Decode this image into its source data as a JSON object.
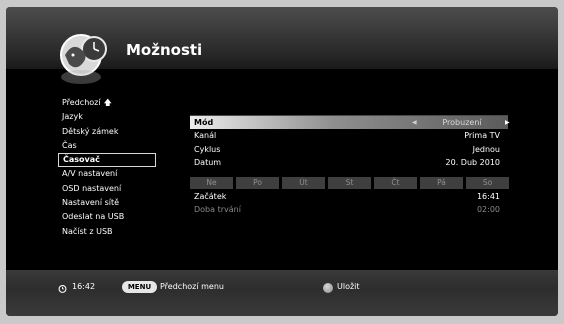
{
  "header": {
    "title": "Možnosti"
  },
  "menu": {
    "items": [
      {
        "label": "Předchozí",
        "has_up_arrow": true
      },
      {
        "label": "Jazyk"
      },
      {
        "label": "Dětský zámek"
      },
      {
        "label": "Čas"
      },
      {
        "label": "Časovač",
        "active": true
      },
      {
        "label": "A/V nastavení"
      },
      {
        "label": "OSD nastavení"
      },
      {
        "label": "Nastavení sítě"
      },
      {
        "label": "Odeslat na USB"
      },
      {
        "label": "Načíst z USB"
      }
    ]
  },
  "settings": {
    "mode": {
      "label": "Mód",
      "value": "Probuzení"
    },
    "channel": {
      "label": "Kanál",
      "value": "Prima TV"
    },
    "cycle": {
      "label": "Cyklus",
      "value": "Jednou"
    },
    "date": {
      "label": "Datum",
      "value": "20. Dub 2010"
    },
    "days": [
      "Ne",
      "Po",
      "Út",
      "St",
      "Čt",
      "Pá",
      "So"
    ],
    "start": {
      "label": "Začátek",
      "value": "16:41"
    },
    "duration": {
      "label": "Doba trvání",
      "value": "02:00"
    }
  },
  "footer": {
    "time": "16:42",
    "menu_key": "MENU",
    "menu_label": "Předchozí menu",
    "save_label": "Uložit"
  },
  "icons": {
    "logo": "dog-and-clock-logo-icon",
    "up": "up-arrow-icon",
    "left": "left-arrow-icon",
    "right": "right-arrow-icon",
    "clock": "alarm-clock-icon",
    "save": "gray-button-icon"
  }
}
